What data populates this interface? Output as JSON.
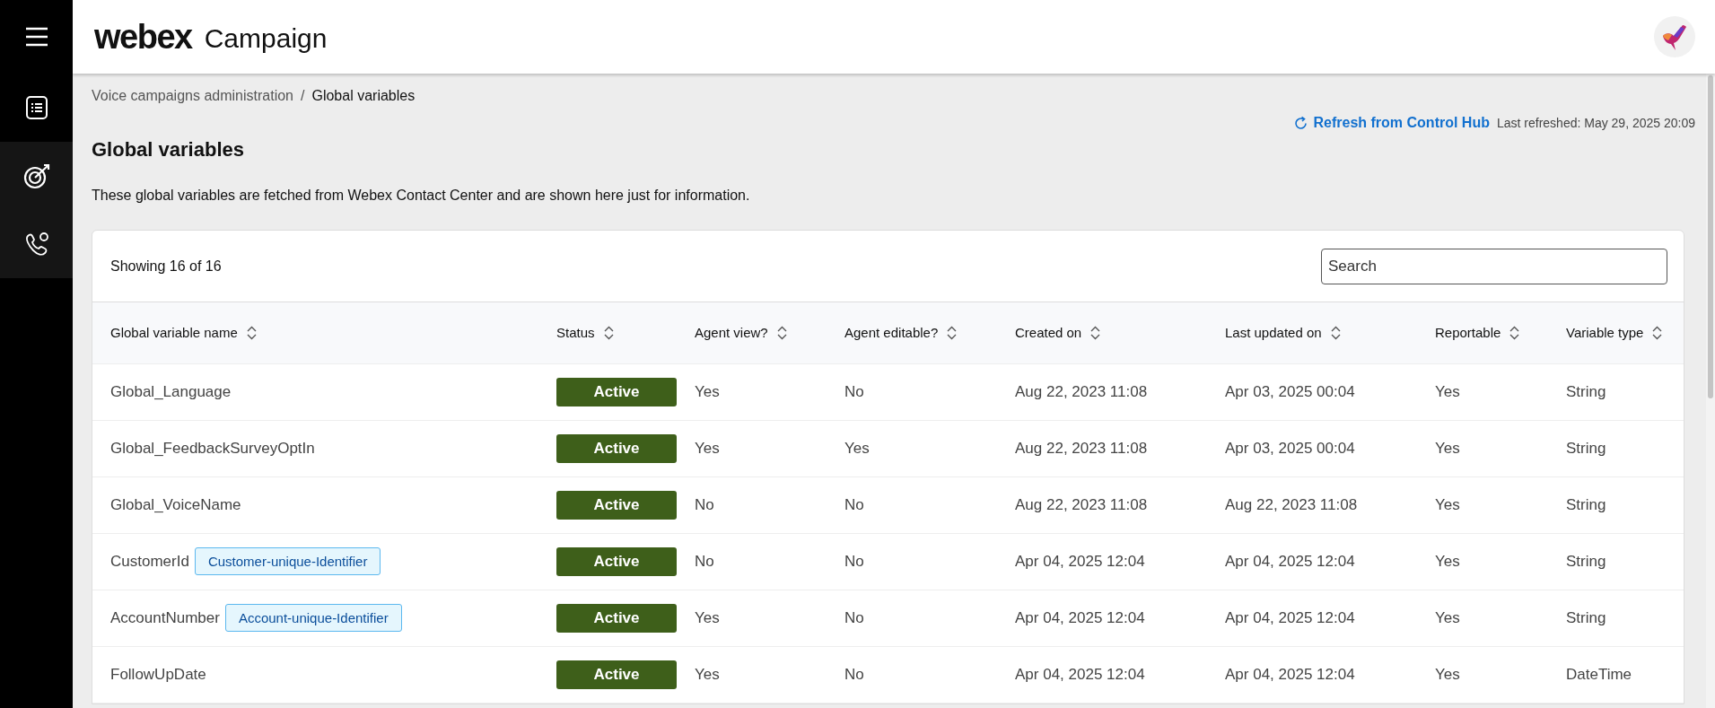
{
  "header": {
    "logo": "webex",
    "product": "Campaign"
  },
  "sidebar": {
    "items": [
      {
        "kind": "list",
        "active": false
      },
      {
        "kind": "target",
        "active": true
      },
      {
        "kind": "phone",
        "active": true
      }
    ]
  },
  "breadcrumb": [
    {
      "label": "Voice campaigns administration",
      "current": false
    },
    {
      "separator": "/"
    },
    {
      "label": "Global variables",
      "current": true
    }
  ],
  "refresh": {
    "link": "Refresh from Control Hub",
    "last_refreshed": "Last refreshed: May 29, 2025 20:09"
  },
  "page_title": "Global variables",
  "description": "These global variables are fetched from Webex Contact Center and are shown here just for information.",
  "table_card": {
    "count": "Showing 16 of 16",
    "search": {
      "placeholder": "Search"
    }
  },
  "table": {
    "columns": [
      "Global variable name",
      "Status",
      "Agent view?",
      "Agent editable?",
      "Created on",
      "Last updated on",
      "Reportable",
      "Variable type"
    ],
    "rows": [
      {
        "name": "Global_Language",
        "status": "Active",
        "agent_view": "Yes",
        "agent_editable": "No",
        "created_on": "Aug 22, 2023 11:08",
        "last_updated_on": "Apr 03, 2025 00:04",
        "reportable": "Yes",
        "variable_type": "String"
      },
      {
        "name": "Global_FeedbackSurveyOptIn",
        "status": "Active",
        "agent_view": "Yes",
        "agent_editable": "Yes",
        "created_on": "Aug 22, 2023 11:08",
        "last_updated_on": "Apr 03, 2025 00:04",
        "reportable": "Yes",
        "variable_type": "String"
      },
      {
        "name": "Global_VoiceName",
        "status": "Active",
        "agent_view": "No",
        "agent_editable": "No",
        "created_on": "Aug 22, 2023 11:08",
        "last_updated_on": "Aug 22, 2023 11:08",
        "reportable": "Yes",
        "variable_type": "String"
      },
      {
        "name": "CustomerId",
        "tag": "Customer-unique-Identifier",
        "status": "Active",
        "agent_view": "No",
        "agent_editable": "No",
        "created_on": "Apr 04, 2025 12:04",
        "last_updated_on": "Apr 04, 2025 12:04",
        "reportable": "Yes",
        "variable_type": "String"
      },
      {
        "name": "AccountNumber",
        "tag": "Account-unique-Identifier",
        "status": "Active",
        "agent_view": "Yes",
        "agent_editable": "No",
        "created_on": "Apr 04, 2025 12:04",
        "last_updated_on": "Apr 04, 2025 12:04",
        "reportable": "Yes",
        "variable_type": "String"
      },
      {
        "name": "FollowUpDate",
        "status": "Active",
        "agent_view": "Yes",
        "agent_editable": "No",
        "created_on": "Apr 04, 2025 12:04",
        "last_updated_on": "Apr 04, 2025 12:04",
        "reportable": "Yes",
        "variable_type": "DateTime"
      }
    ]
  }
}
